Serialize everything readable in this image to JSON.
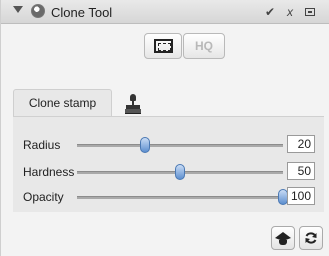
{
  "panel": {
    "title": "Clone Tool",
    "title_icon": "gimp-dock-icon",
    "controls": {
      "check": "✔",
      "close": "x"
    }
  },
  "mode_buttons": [
    {
      "name": "clone-selection-button",
      "icon": "screen-selection-icon",
      "state": "active"
    },
    {
      "name": "hq-button",
      "label": "HQ",
      "state": "disabled"
    }
  ],
  "tabs": [
    {
      "label": "Clone stamp",
      "selected": true
    },
    {
      "icon": "stamp-icon",
      "selected": false
    }
  ],
  "settings": [
    {
      "label": "Radius",
      "value": "20",
      "slider_fraction": 0.33
    },
    {
      "label": "Hardness",
      "value": "50",
      "slider_fraction": 0.5
    },
    {
      "label": "Opacity",
      "value": "100",
      "slider_fraction": 1.0
    }
  ],
  "bottom_buttons": [
    {
      "name": "learn-button",
      "icon": "graduation-cap-icon"
    },
    {
      "name": "reset-button",
      "icon": "reset-icon"
    }
  ],
  "colors": {
    "slider_knob": "#5d8fcf",
    "panel_bg": "#f3f3f3",
    "settings_bg": "#e8e8e8",
    "hq_disabled": "#b8b8b8"
  }
}
